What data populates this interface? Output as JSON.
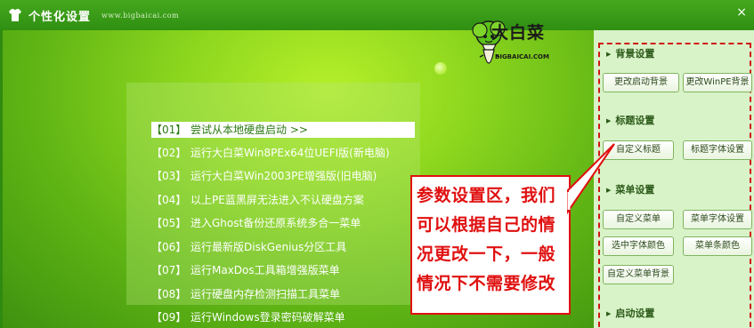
{
  "window": {
    "title": "个性化设置",
    "url": "www.bigbaicai.com",
    "close_symbol": "×"
  },
  "logo": {
    "name": "大白菜",
    "url": "BIGBAICAI.COM"
  },
  "menu": {
    "items": [
      {
        "num": "【01】",
        "label": "尝试从本地硬盘启动 >>"
      },
      {
        "num": "【02】",
        "label": "运行大白菜Win8PEx64位UEFI版(新电脑)"
      },
      {
        "num": "【03】",
        "label": "运行大白菜Win2003PE增强版(旧电脑)"
      },
      {
        "num": "【04】",
        "label": "以上PE蓝黑屏无法进入不认硬盘方案"
      },
      {
        "num": "【05】",
        "label": "进入Ghost备份还原系统多合一菜单"
      },
      {
        "num": "【06】",
        "label": "运行最新版DiskGenius分区工具"
      },
      {
        "num": "【07】",
        "label": "运行MaxDos工具箱增强版菜单"
      },
      {
        "num": "【08】",
        "label": "运行硬盘内存检测扫描工具菜单"
      },
      {
        "num": "【09】",
        "label": "运行Windows登录密码破解菜单"
      }
    ]
  },
  "callout": {
    "lines": [
      "参数设置区，我们",
      "可以根据自己的情",
      "况更改一下，一般",
      "情况下不需要修改"
    ],
    "color": "#e01010"
  },
  "settings": {
    "background": {
      "title": "背景设置",
      "change_boot_bg": "更改启动背景",
      "change_winpe_bg": "更改WinPE背景"
    },
    "title_section": {
      "title": "标题设置",
      "custom_title": "自定义标题",
      "title_font": "标题字体设置"
    },
    "menu_section": {
      "title": "菜单设置",
      "custom_menu": "自定义菜单",
      "menu_font": "菜单字体设置",
      "selected_font_color": "选中字体颜色",
      "menu_bar_color": "菜单条颜色",
      "custom_menu_bg": "自定义菜单背景"
    },
    "boot_section": {
      "title": "启动设置"
    }
  }
}
